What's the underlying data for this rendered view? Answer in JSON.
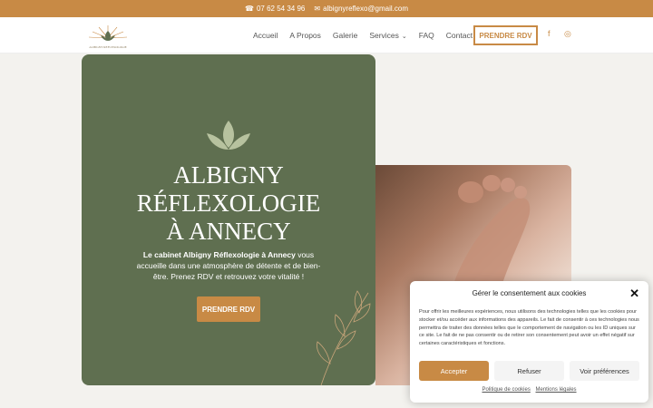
{
  "topbar": {
    "phone_icon": "phone-icon",
    "phone": "07 62 54 34 96",
    "mail_icon": "mail-icon",
    "email": "albignyreflexo@gmail.com",
    "background": "#c88a45"
  },
  "header": {
    "logo_text": "ALBIGNY REFLEXOLOGIE",
    "nav": [
      "Accueil",
      "A Propos",
      "Galerie",
      "Services",
      "FAQ",
      "Contact"
    ],
    "services_chevron": "⌄",
    "cta": "PRENDRE RDV",
    "social": {
      "facebook": "f",
      "instagram": "◎"
    }
  },
  "hero": {
    "title_lines": [
      "ALBIGNY",
      "RÉFLEXOLOGIE",
      "À ANNECY"
    ],
    "text_bold": "Le cabinet Albigny Réflexologie à Annecy",
    "text_rest": " vous accueille dans une atmosphère de détente et de bien-être. Prenez RDV et retrouvez votre vitalité !",
    "cta": "PRENDRE RDV",
    "background": "#5f6f50",
    "accent": "#c88a45"
  },
  "cookie": {
    "title": "Gérer le consentement aux cookies",
    "close": "✕",
    "text": "Pour offrir les meilleures expériences, nous utilisons des technologies telles que les cookies pour stocker et/ou accéder aux informations des appareils. Le fait de consentir à ces technologies nous permettra de traiter des données telles que le comportement de navigation ou les ID uniques sur ce site. Le fait de ne pas consentir ou de retirer son consentement peut avoir un effet négatif sur certaines caractéristiques et fonctions.",
    "accept": "Accepter",
    "refuse": "Refuser",
    "prefs": "Voir préférences",
    "link_cookies": "Politique de cookies",
    "link_legal": "Mentions légales"
  }
}
